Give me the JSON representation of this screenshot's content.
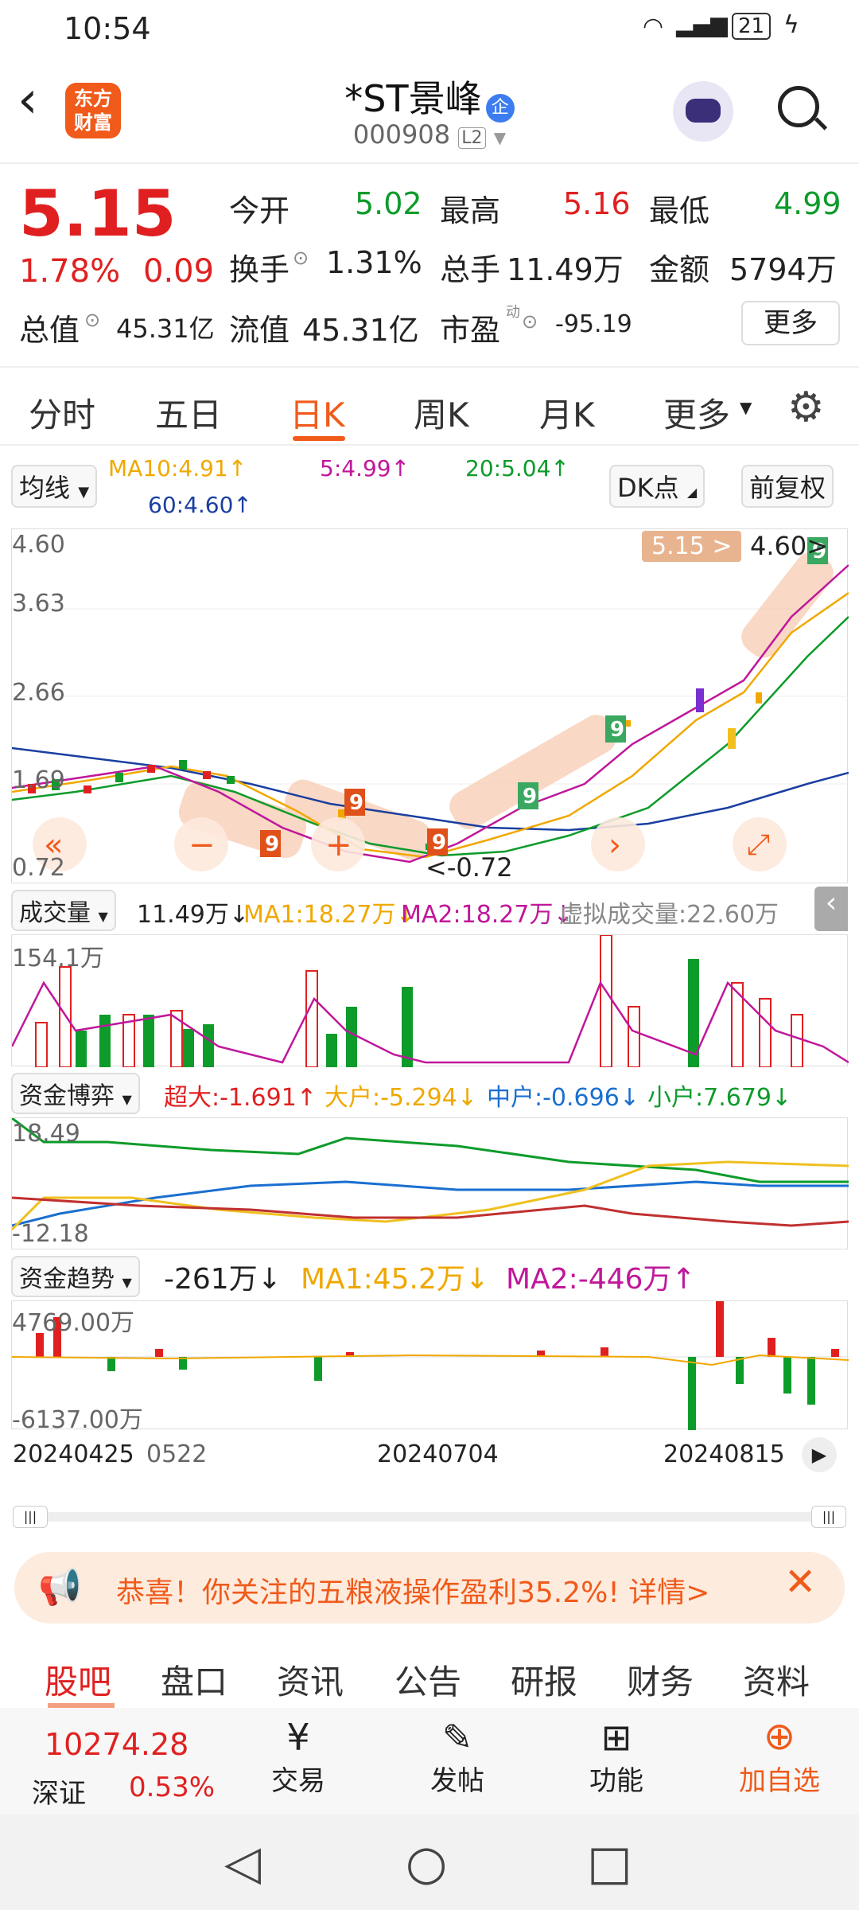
{
  "status": {
    "time": "10:54",
    "battery": "21"
  },
  "header": {
    "brand_line1": "东方",
    "brand_line2": "财富",
    "title": "*ST景峰",
    "badge": "企",
    "code": "000908",
    "level": "L2"
  },
  "quote": {
    "price": "5.15",
    "pct": "1.78%",
    "chg": "0.09",
    "open_label": "今开",
    "open": "5.02",
    "high_label": "最高",
    "high": "5.16",
    "low_label": "最低",
    "low": "4.99",
    "turnover_label": "换手",
    "turnover": "1.31%",
    "vol_label": "总手",
    "vol": "11.49万",
    "amount_label": "金额",
    "amount": "5794万",
    "mcap_label": "总值",
    "mcap": "45.31亿",
    "float_label": "流值",
    "float": "45.31亿",
    "pe_label": "市盈",
    "pe_sup": "动",
    "pe": "-95.19",
    "more": "更多"
  },
  "tabs": [
    "分时",
    "五日",
    "日K",
    "周K",
    "月K",
    "更多"
  ],
  "ma": {
    "selector": "均线",
    "ma10": "MA10:4.91↑",
    "ma5": "5:4.99↑",
    "ma20": "20:5.04↑",
    "ma60": "60:4.60↑",
    "dk": "DK点",
    "fq": "前复权"
  },
  "kline": {
    "y_top": "4.60",
    "y2": "3.63",
    "y3": "2.66",
    "y4": "1.69",
    "y_bot": "0.72",
    "cur_price": "5.15 >",
    "max_label": "4.60>",
    "min_label": "<-0.72"
  },
  "volume": {
    "selector": "成交量",
    "vol": "11.49万↓",
    "ma1": "MA1:18.27万↓",
    "ma2": "MA2:18.27万↓",
    "virtual": "虚拟成交量:22.60万",
    "max": "154.1万"
  },
  "fund": {
    "selector": "资金博弈",
    "super": "超大:-1.691↑",
    "large": "大户:-5.294↓",
    "medium": "中户:-0.696↓",
    "small": "小户:7.679↓",
    "max": "18.49",
    "min": "-12.18"
  },
  "trend": {
    "selector": "资金趋势",
    "value": "-261万↓",
    "ma1": "MA1:45.2万↓",
    "ma2": "MA2:-446万↑",
    "max": "4769.00万",
    "min": "-6137.00万"
  },
  "dates": {
    "d1": "20240425",
    "d2": "0522",
    "d3": "20240704",
    "d4": "20240815"
  },
  "banner": {
    "text": "恭喜！你关注的五粮液操作盈利35.2%! 详情>"
  },
  "bottom_tabs": [
    "股吧",
    "盘口",
    "资讯",
    "公告",
    "研报",
    "财务",
    "资料"
  ],
  "bottom_bar": {
    "index_value": "10274.28",
    "index_name": "深证",
    "index_pct": "0.53%",
    "trade": "交易",
    "post": "发帖",
    "func": "功能",
    "add": "加自选"
  },
  "colors": {
    "up": "#e02020",
    "down": "#0d9b2a",
    "brand": "#f05a1a"
  }
}
